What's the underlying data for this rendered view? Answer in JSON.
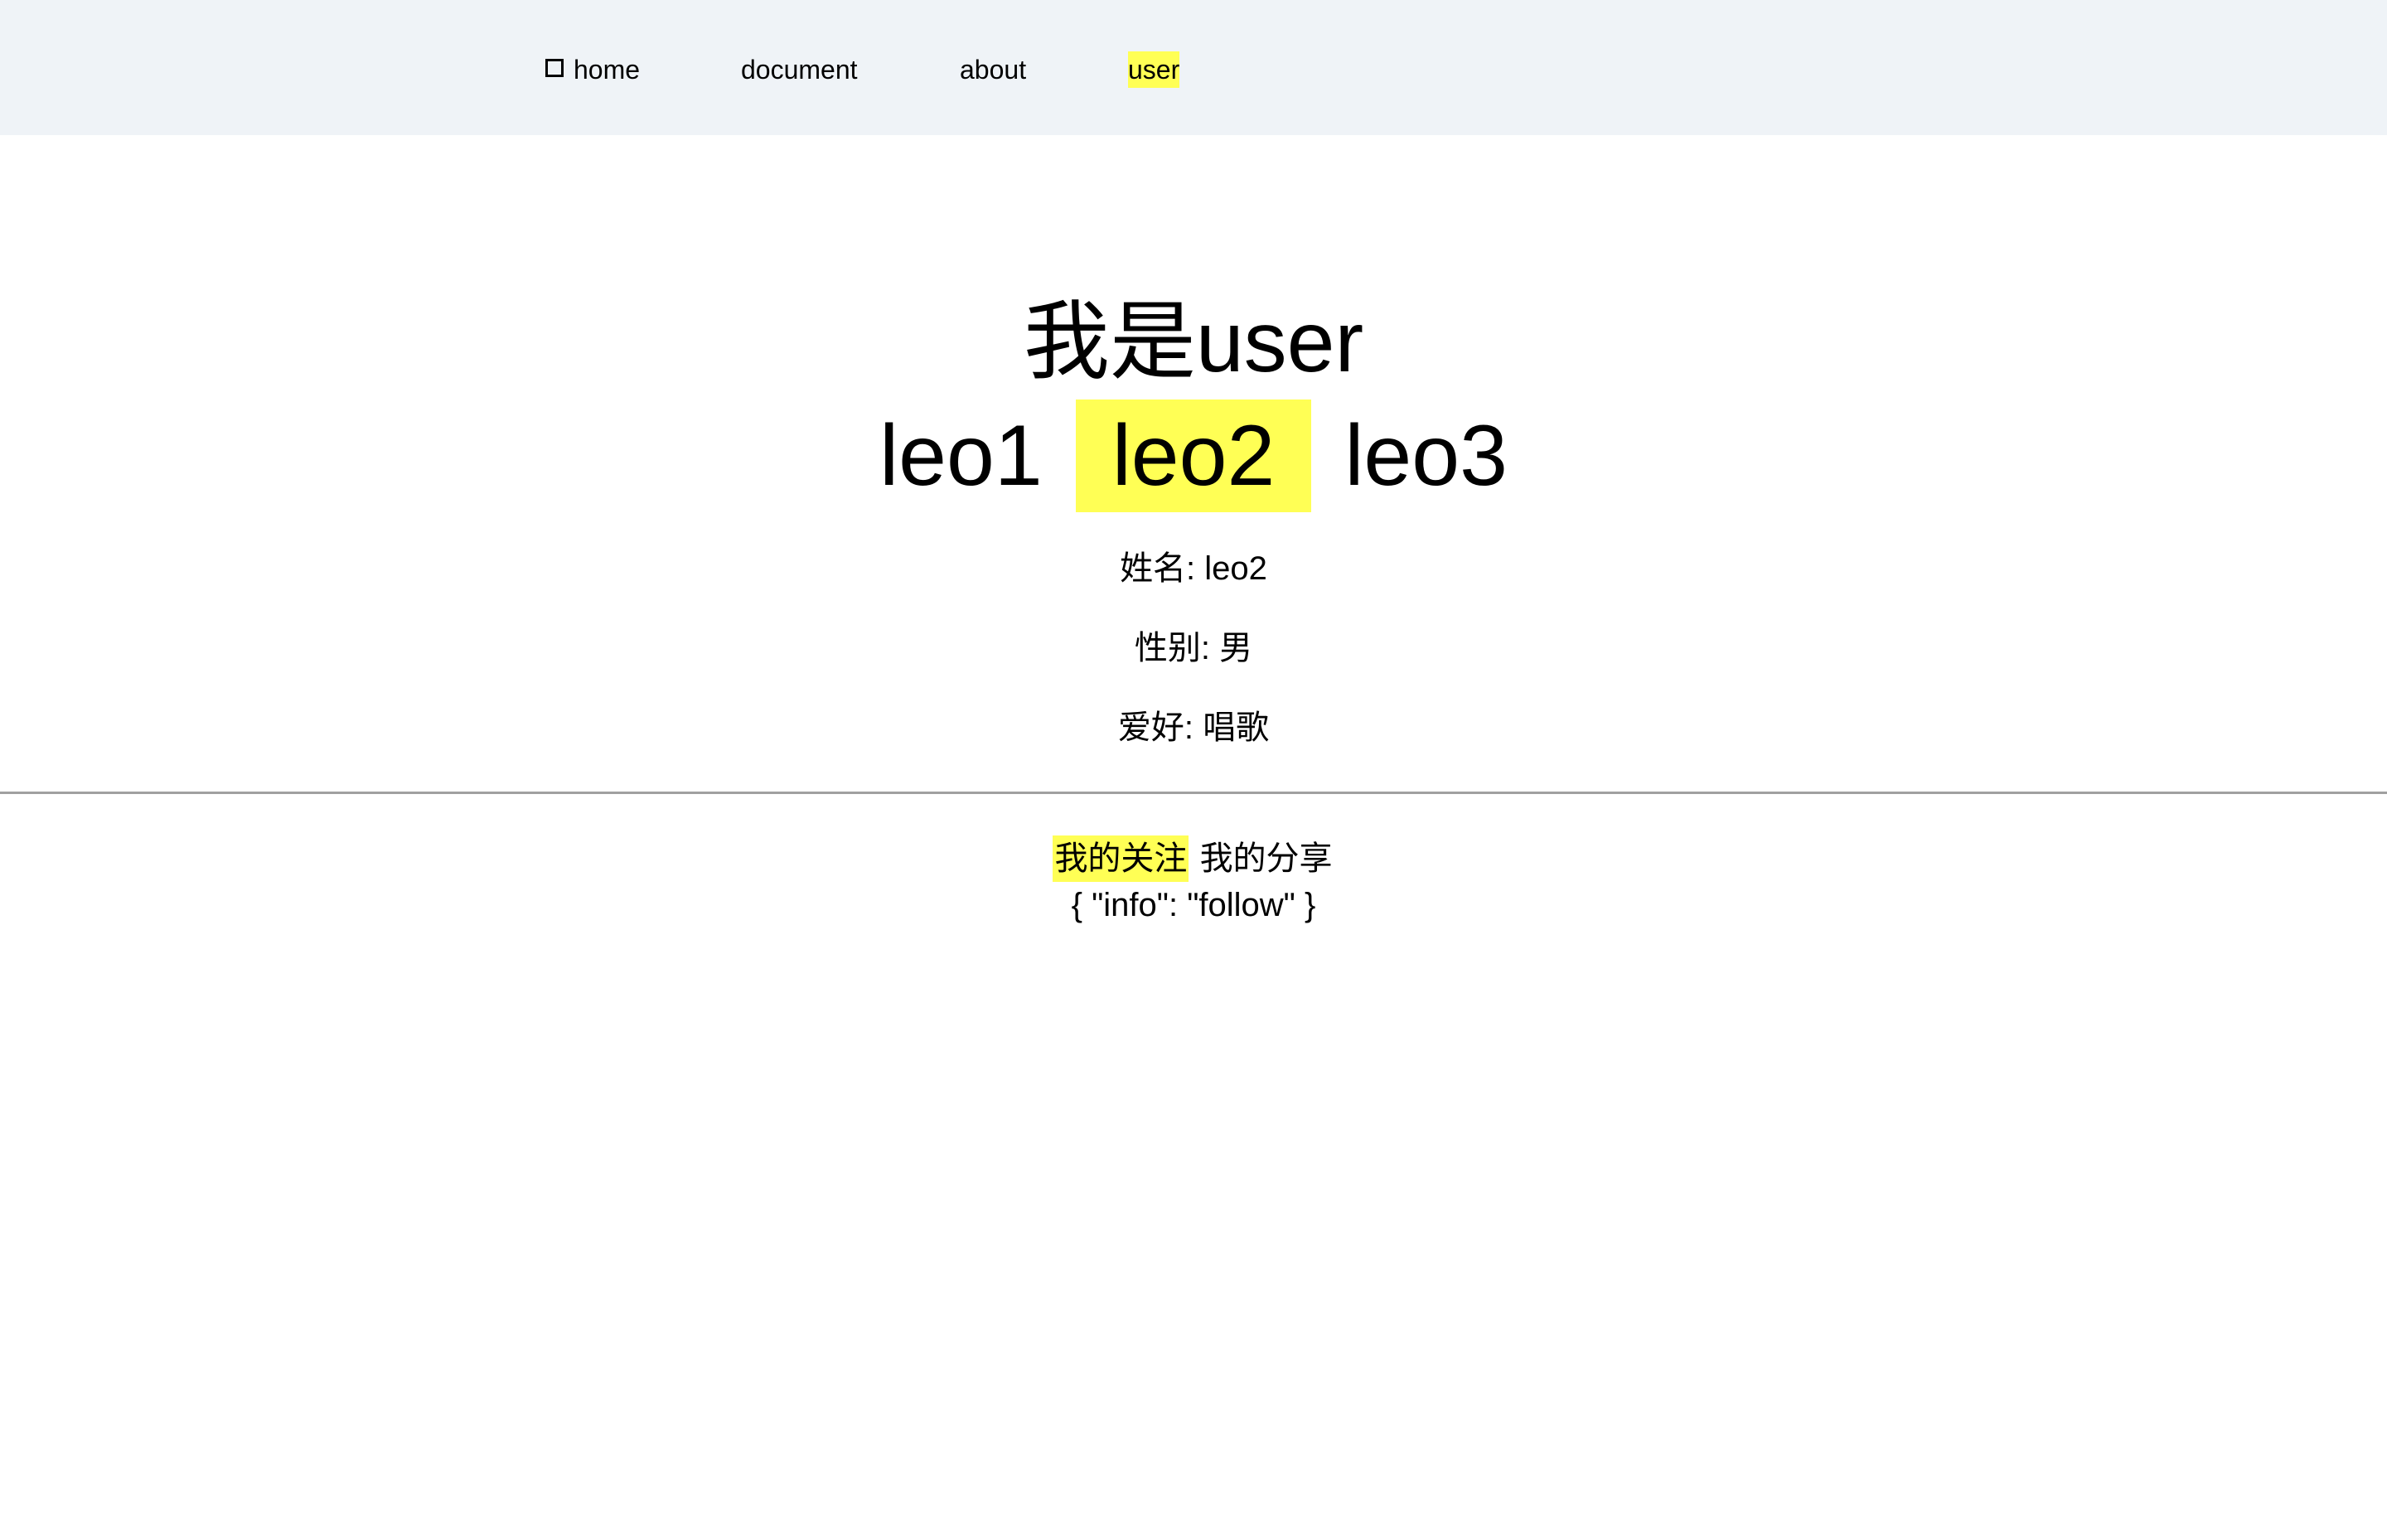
{
  "nav": {
    "items": [
      {
        "label": "home",
        "icon": "broken-image-icon",
        "active": false
      },
      {
        "label": "document",
        "active": false
      },
      {
        "label": "about",
        "active": false
      },
      {
        "label": "user",
        "active": true
      }
    ]
  },
  "main": {
    "title": "我是user",
    "users": [
      {
        "label": "leo1",
        "active": false
      },
      {
        "label": "leo2",
        "active": true
      },
      {
        "label": "leo3",
        "active": false
      }
    ],
    "details": {
      "name": "姓名: leo2",
      "gender": "性别: 男",
      "hobby": "爱好: 唱歌"
    }
  },
  "sub": {
    "tabs": [
      {
        "label": "我的关注",
        "active": true
      },
      {
        "label": "我的分享",
        "active": false
      }
    ],
    "output": "{ \"info\": \"follow\" }"
  },
  "colors": {
    "nav_background": "#eff3f7",
    "highlight": "#ffff55",
    "divider": "#a0a0a0"
  }
}
